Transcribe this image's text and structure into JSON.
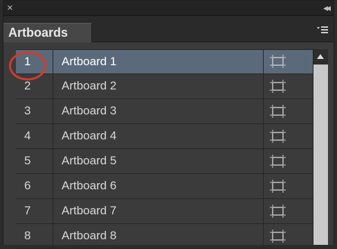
{
  "window": {
    "close_glyph": "×",
    "collapse_glyph": "◂◂"
  },
  "tab": {
    "label": "Artboards"
  },
  "icons": {
    "close": "close-icon",
    "collapse": "double-chevron-left-icon",
    "panel_menu": "panel-menu-icon",
    "artboard": "artboard-options-icon",
    "scroll_up": "arrow-up-icon"
  },
  "colors": {
    "selected_row": "#5b6a7a",
    "panel_bg": "#3b3b3b",
    "annotation_circle": "#d43a2f"
  },
  "artboards": [
    {
      "number": "1",
      "name": "Artboard 1",
      "selected": true
    },
    {
      "number": "2",
      "name": "Artboard 2",
      "selected": false
    },
    {
      "number": "3",
      "name": "Artboard 3",
      "selected": false
    },
    {
      "number": "4",
      "name": "Artboard 4",
      "selected": false
    },
    {
      "number": "5",
      "name": "Artboard 5",
      "selected": false
    },
    {
      "number": "6",
      "name": "Artboard 6",
      "selected": false
    },
    {
      "number": "7",
      "name": "Artboard 7",
      "selected": false
    },
    {
      "number": "8",
      "name": "Artboard 8",
      "selected": false
    }
  ]
}
